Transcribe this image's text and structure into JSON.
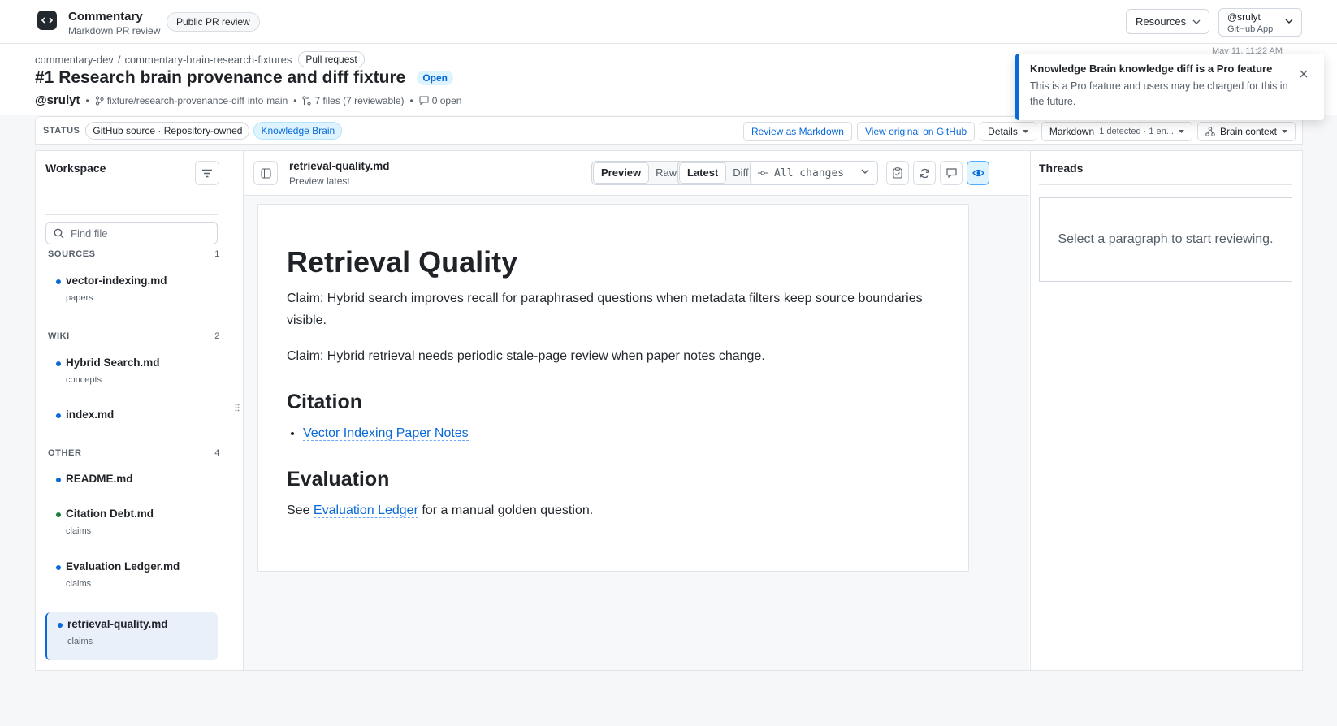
{
  "app": {
    "name": "Commentary",
    "subtitle": "Markdown PR review",
    "mode_pill": "Public PR review"
  },
  "header": {
    "resources_label": "Resources",
    "user_name": "@srulyt",
    "user_sub": "GitHub App"
  },
  "pr": {
    "org": "commentary-dev",
    "separator": "/",
    "repo": "commentary-brain-research-fixtures",
    "type_badge": "Pull request",
    "title": "#1 Research brain provenance and diff fixture",
    "state": "Open",
    "author": "@srulyt",
    "head_branch": "fixture/research-provenance-diff",
    "into": "into",
    "base_branch": "main",
    "files": "7 files (7 reviewable)",
    "comments": "0 open",
    "timestamp": "May 11, 11:22 AM"
  },
  "toast": {
    "title": "Knowledge Brain knowledge diff is a Pro feature",
    "body": "This is a Pro feature and users may be charged for this in the future."
  },
  "status": {
    "label": "STATUS",
    "chips": [
      "GitHub source · Repository-owned",
      "Knowledge Brain"
    ],
    "review_markdown": "Review as Markdown",
    "view_original": "View original on GitHub",
    "details": "Details",
    "markdown": "Markdown",
    "markdown_sub": "1 detected · 1 en...",
    "brain_context": "Brain context"
  },
  "sidebar": {
    "title": "Workspace",
    "find_placeholder": "Find file",
    "groups": [
      {
        "name": "SOURCES",
        "count": "1",
        "items": [
          {
            "name": "vector-indexing.md",
            "sub": "papers"
          }
        ]
      },
      {
        "name": "WIKI",
        "count": "2",
        "items": [
          {
            "name": "Hybrid Search.md",
            "sub": "concepts"
          },
          {
            "name": "index.md",
            "sub": ""
          }
        ]
      },
      {
        "name": "OTHER",
        "count": "4",
        "items": [
          {
            "name": "README.md",
            "sub": ""
          },
          {
            "name": "Citation Debt.md",
            "sub": "claims"
          },
          {
            "name": "Evaluation Ledger.md",
            "sub": "claims"
          },
          {
            "name": "retrieval-quality.md",
            "sub": "claims"
          }
        ]
      }
    ]
  },
  "viewer": {
    "file": "retrieval-quality.md",
    "sub": "Preview latest",
    "preview": "Preview",
    "raw": "Raw",
    "latest": "Latest",
    "diff": "Diff",
    "changes": "All changes"
  },
  "document": {
    "h1": "Retrieval Quality",
    "p1": "Claim: Hybrid search improves recall for paraphrased questions when metadata filters keep source boundaries visible.",
    "p2": "Claim: Hybrid retrieval needs periodic stale-page review when paper notes change.",
    "h2_citation": "Citation",
    "citation_link": "Vector Indexing Paper Notes",
    "h2_evaluation": "Evaluation",
    "eval_pre": "See",
    "eval_link": "Evaluation Ledger",
    "eval_post": "for a manual golden question."
  },
  "threads": {
    "title": "Threads",
    "empty": "Select a paragraph to start reviewing."
  },
  "colors": {
    "accent": "#0969da",
    "success": "#1a7f37"
  }
}
